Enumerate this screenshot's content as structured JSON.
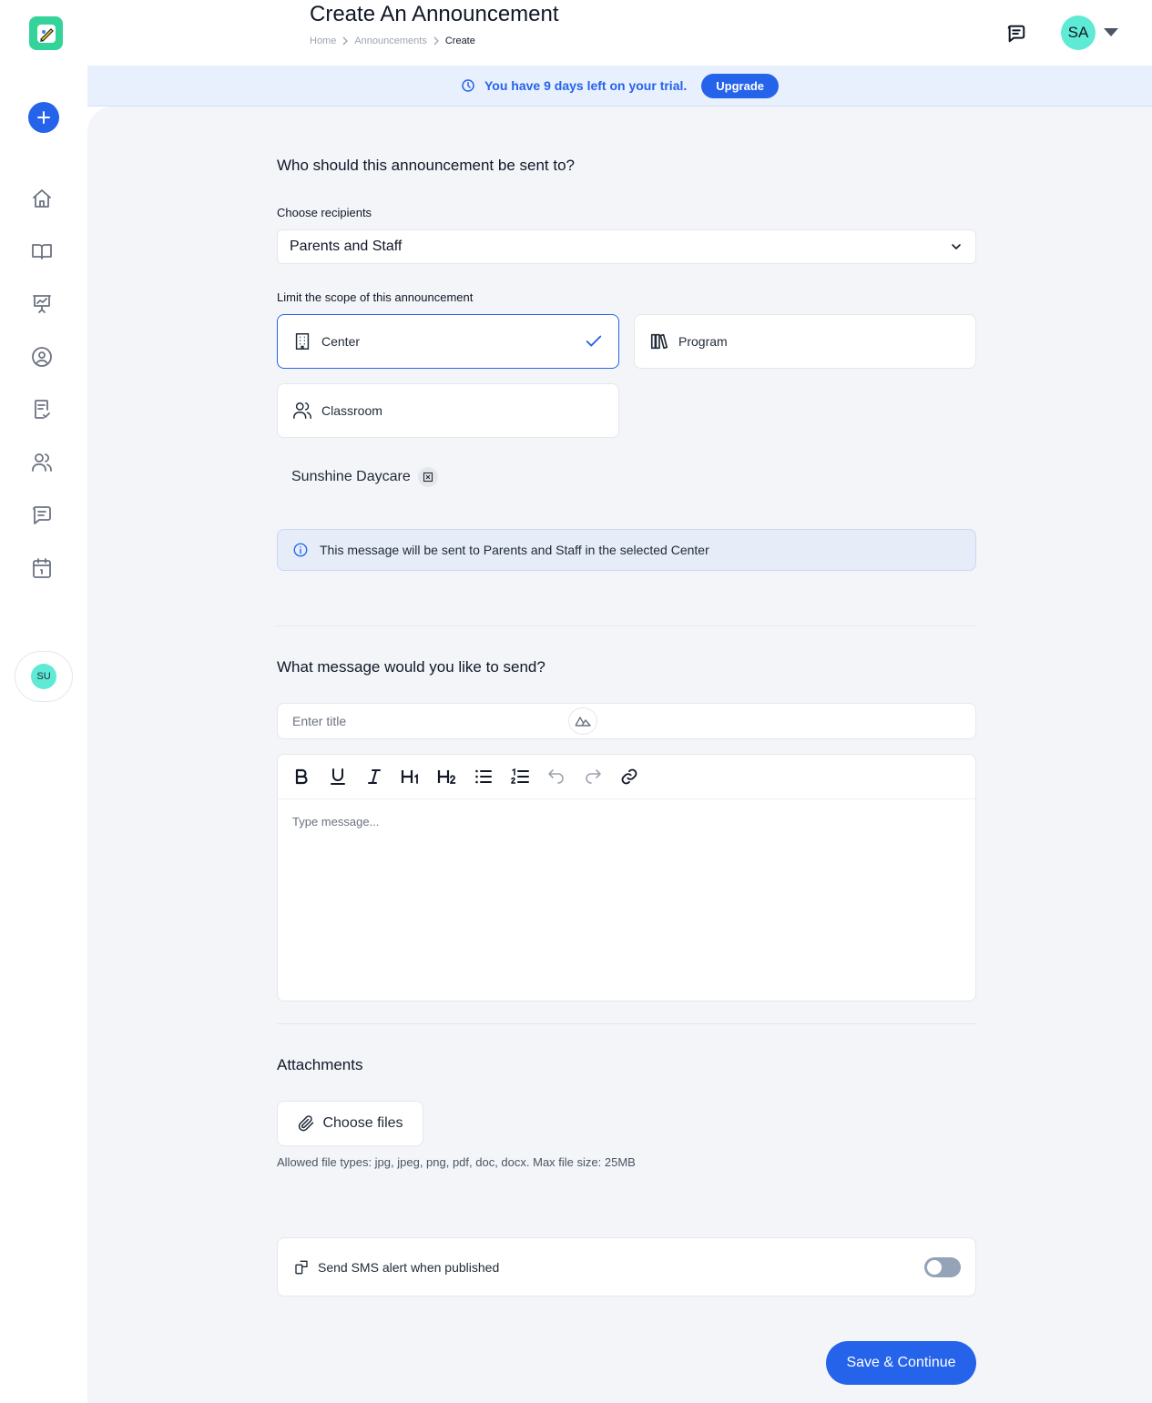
{
  "header": {
    "title": "Create An Announcement",
    "breadcrumb": [
      "Home",
      "Announcements",
      "Create"
    ],
    "avatar_initials": "SA"
  },
  "trial": {
    "prefix": "You have",
    "days": "9 days",
    "suffix": "left on your trial.",
    "upgrade_label": "Upgrade"
  },
  "sidebar": {
    "nav_icons": [
      "home-icon",
      "book-icon",
      "presentation-icon",
      "user-circle-icon",
      "clipboard-check-icon",
      "users-icon",
      "message-icon",
      "calendar-icon"
    ],
    "user_initials": "SU"
  },
  "recipients": {
    "heading": "Who should this announcement be sent to?",
    "choose_label": "Choose recipients",
    "selected": "Parents and Staff"
  },
  "scope": {
    "label": "Limit the scope of this announcement",
    "options": [
      {
        "label": "Center",
        "icon": "building-icon",
        "selected": true
      },
      {
        "label": "Program",
        "icon": "books-icon",
        "selected": false
      },
      {
        "label": "Classroom",
        "icon": "users-icon",
        "selected": false
      }
    ],
    "selected_tag": "Sunshine Daycare"
  },
  "info": {
    "message": "This message will be sent to Parents and Staff in the selected Center"
  },
  "message": {
    "heading": "What message would you like to send?",
    "title_placeholder": "Enter title",
    "body_placeholder": "Type message...",
    "toolbar": [
      "bold-icon",
      "underline-icon",
      "italic-icon",
      "heading-1-icon",
      "heading-2-icon",
      "bullet-list-icon",
      "numbered-list-icon",
      "undo-icon",
      "redo-icon",
      "link-icon"
    ]
  },
  "attachments": {
    "heading": "Attachments",
    "button_label": "Choose files",
    "allowed": "Allowed file types: jpg, jpeg, png, pdf, doc, docx. Max file size: 25MB"
  },
  "sms": {
    "label": "Send SMS alert when published",
    "enabled": false
  },
  "actions": {
    "save_label": "Save & Continue"
  },
  "colors": {
    "accent": "#2563eb",
    "avatar": "#5eead4",
    "background": "#f3f5f9"
  }
}
